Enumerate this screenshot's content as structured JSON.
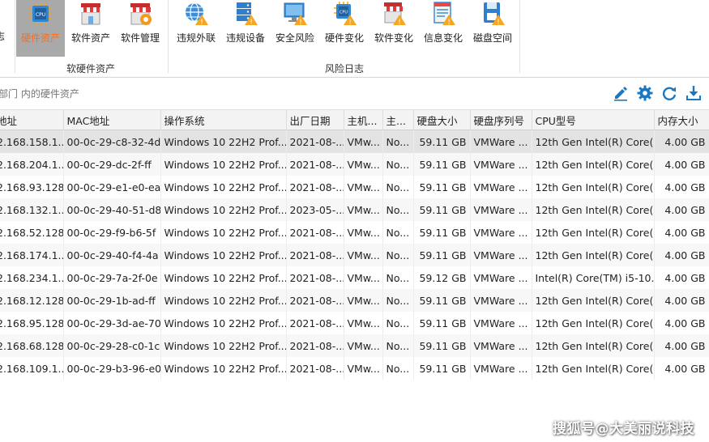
{
  "ribbon": {
    "partial_left_label": "志",
    "groups": [
      {
        "label": "软硬件资产",
        "buttons": [
          {
            "label": "硬件资产",
            "icon": "cpu-chip-icon",
            "active": true
          },
          {
            "label": "软件资产",
            "icon": "store-icon",
            "active": false
          },
          {
            "label": "软件管理",
            "icon": "store-gear-icon",
            "active": false
          }
        ]
      },
      {
        "label": "风险日志",
        "buttons": [
          {
            "label": "违规外联",
            "icon": "globe-warning-icon"
          },
          {
            "label": "违规设备",
            "icon": "server-warning-icon"
          },
          {
            "label": "安全风险",
            "icon": "monitor-warning-icon"
          },
          {
            "label": "硬件变化",
            "icon": "cpu-warning-icon"
          },
          {
            "label": "软件变化",
            "icon": "store-warning-icon"
          },
          {
            "label": "信息变化",
            "icon": "document-warning-icon"
          },
          {
            "label": "磁盘空间",
            "icon": "disk-warning-icon"
          }
        ]
      }
    ]
  },
  "filter": {
    "text": "部门 内的硬件资产"
  },
  "toolbar": {
    "icons": [
      "edit-icon",
      "settings-icon",
      "refresh-icon",
      "download-icon"
    ],
    "accent": "#1a78c2"
  },
  "table": {
    "columns": [
      "地址",
      "MAC地址",
      "操作系统",
      "出厂日期",
      "主机...",
      "主...",
      "硬盘大小",
      "硬盘序列号",
      "CPU型号",
      "内存大小"
    ],
    "rows": [
      [
        "2.168.158.1...",
        "00-0c-29-c8-32-4d",
        "Windows 10 22H2 Prof...",
        "2021-08-...",
        "VMw...",
        "No...",
        "59.11 GB",
        "VMWare ...",
        "12th Gen Intel(R) Core(...",
        "4.00 GB"
      ],
      [
        "2.168.204.1...",
        "00-0c-29-dc-2f-ff",
        "Windows 10 22H2 Prof...",
        "2021-08-...",
        "VMw...",
        "No...",
        "59.11 GB",
        "VMWare ...",
        "12th Gen Intel(R) Core(...",
        "4.00 GB"
      ],
      [
        "2.168.93.128",
        "00-0c-29-e1-e0-ea",
        "Windows 10 22H2 Prof...",
        "2021-08-...",
        "VMw...",
        "No...",
        "59.11 GB",
        "VMWare ...",
        "12th Gen Intel(R) Core(...",
        "4.00 GB"
      ],
      [
        "2.168.132.1...",
        "00-0c-29-40-51-d8",
        "Windows 10 22H2 Prof...",
        "2023-05-...",
        "VMw...",
        "No...",
        "59.11 GB",
        "VMWare ...",
        "12th Gen Intel(R) Core(...",
        "4.00 GB"
      ],
      [
        "2.168.52.128",
        "00-0c-29-f9-b6-5f",
        "Windows 10 22H2 Prof...",
        "2021-08-...",
        "VMw...",
        "No...",
        "59.11 GB",
        "VMWare ...",
        "12th Gen Intel(R) Core(...",
        "4.00 GB"
      ],
      [
        "2.168.174.1...",
        "00-0c-29-40-f4-4a",
        "Windows 10 22H2 Prof...",
        "2021-08-...",
        "VMw...",
        "No...",
        "59.11 GB",
        "VMWare ...",
        "12th Gen Intel(R) Core(...",
        "4.00 GB"
      ],
      [
        "2.168.234.1...",
        "00-0c-29-7a-2f-0e",
        "Windows 10 22H2 Prof...",
        "2021-08-...",
        "VMw...",
        "No...",
        "59.12 GB",
        "VMWare ...",
        "Intel(R) Core(TM) i5-10...",
        "4.00 GB"
      ],
      [
        "2.168.12.128",
        "00-0c-29-1b-ad-ff",
        "Windows 10 22H2 Prof...",
        "2021-08-...",
        "VMw...",
        "No...",
        "59.11 GB",
        "VMWare ...",
        "12th Gen Intel(R) Core(...",
        "4.00 GB"
      ],
      [
        "2.168.95.128",
        "00-0c-29-3d-ae-70",
        "Windows 10 22H2 Prof...",
        "2021-08-...",
        "VMw...",
        "No...",
        "59.11 GB",
        "VMWare ...",
        "12th Gen Intel(R) Core(...",
        "4.00 GB"
      ],
      [
        "2.168.68.128",
        "00-0c-29-28-c0-1c",
        "Windows 10 22H2 Prof...",
        "2021-08-...",
        "VMw...",
        "No...",
        "59.11 GB",
        "VMWare ...",
        "12th Gen Intel(R) Core(...",
        "4.00 GB"
      ],
      [
        "2.168.109.1...",
        "00-0c-29-b3-96-e0",
        "Windows 10 22H2 Prof...",
        "2021-08-...",
        "VMw...",
        "No...",
        "59.11 GB",
        "VMWare ...",
        "12th Gen Intel(R) Core(...",
        "4.00 GB"
      ]
    ]
  },
  "watermark": "搜狐号@大美丽说科技"
}
